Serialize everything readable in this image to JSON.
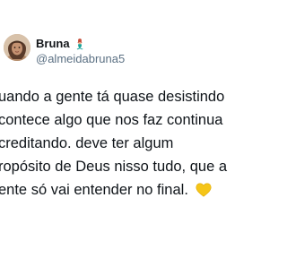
{
  "author": {
    "display_name": "Bruna",
    "name_emoji_icon": "mermaid-icon",
    "handle": "@almeidabruna5",
    "avatar_icon": "profile-photo"
  },
  "tweet": {
    "lines": [
      "uando a gente tá quase desistindo",
      "contece algo que nos faz continua",
      "creditando. deve ter algum",
      "ropósito de Deus nisso tudo, que a",
      "ente só vai entender no final."
    ],
    "end_emoji_icon": "yellow-heart-icon"
  },
  "colors": {
    "background": "#ffffff",
    "text": "#0f1419",
    "handle": "#5b7083",
    "heart": "#f5c518"
  }
}
